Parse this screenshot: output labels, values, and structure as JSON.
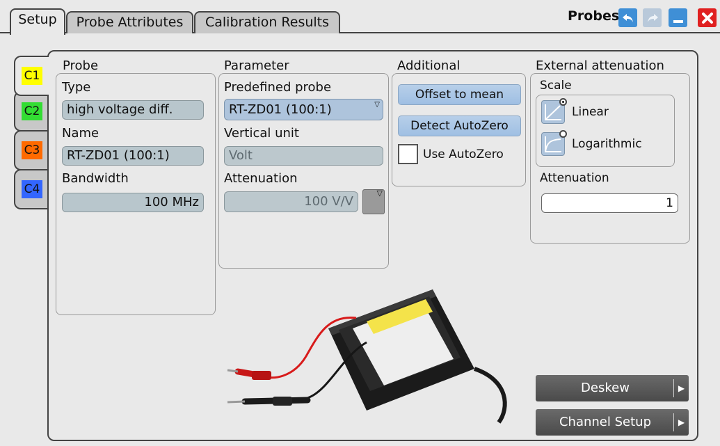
{
  "window": {
    "title": "Probes",
    "buttons": [
      "undo-icon",
      "redo-icon",
      "minimize-icon",
      "close-icon"
    ]
  },
  "tabs": [
    {
      "label": "Setup",
      "active": true
    },
    {
      "label": "Probe Attributes",
      "active": false
    },
    {
      "label": "Calibration Results",
      "active": false
    }
  ],
  "channels": [
    {
      "label": "C1",
      "color": "#ffff00",
      "active": true
    },
    {
      "label": "C2",
      "color": "#33dd33",
      "active": false
    },
    {
      "label": "C3",
      "color": "#ff6a00",
      "active": false
    },
    {
      "label": "C4",
      "color": "#3366ff",
      "active": false
    }
  ],
  "probe": {
    "title": "Probe",
    "type_label": "Type",
    "type_value": "high voltage diff.",
    "name_label": "Name",
    "name_value": "RT-ZD01 (100:1)",
    "bandwidth_label": "Bandwidth",
    "bandwidth_value": "100 MHz"
  },
  "parameter": {
    "title": "Parameter",
    "predefined_label": "Predefined probe",
    "predefined_value": "RT-ZD01 (100:1)",
    "vertical_unit_label": "Vertical unit",
    "vertical_unit_value": "Volt",
    "attenuation_label": "Attenuation",
    "attenuation_value": "100 V/V"
  },
  "additional": {
    "title": "Additional",
    "offset_button": "Offset to mean",
    "detect_button": "Detect AutoZero",
    "use_autozero_label": "Use AutoZero",
    "use_autozero_checked": false
  },
  "external": {
    "title": "External attenuation",
    "scale_label": "Scale",
    "linear_label": "Linear",
    "linear_selected": true,
    "log_label": "Logarithmic",
    "log_selected": false,
    "attenuation_label": "Attenuation",
    "attenuation_value": "1"
  },
  "actions": {
    "deskew": "Deskew",
    "channel_setup": "Channel Setup"
  },
  "colors": {
    "accent_blue": "#9fbfe3",
    "field_gray": "#b8c6cc",
    "close_red": "#e02020"
  }
}
